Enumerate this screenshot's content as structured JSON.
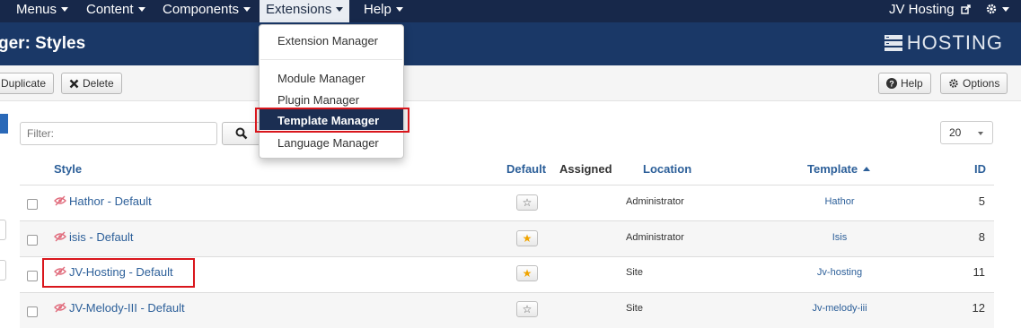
{
  "navbar": {
    "menus": [
      {
        "label": "Menus"
      },
      {
        "label": "Content"
      },
      {
        "label": "Components"
      },
      {
        "label": "Extensions"
      },
      {
        "label": "Help"
      }
    ],
    "site_link": "JV Hosting"
  },
  "header": {
    "title": "ger: Styles",
    "brand": "HOSTING"
  },
  "toolbar": {
    "duplicate": "Duplicate",
    "delete": "Delete",
    "help": "Help",
    "options": "Options"
  },
  "filter": {
    "placeholder": "Filter:"
  },
  "list_limit": "20",
  "extensions_menu": {
    "items": [
      "Extension Manager",
      "Module Manager",
      "Plugin Manager",
      "Template Manager",
      "Language Manager"
    ],
    "active": "Template Manager"
  },
  "table": {
    "headers": {
      "style": "Style",
      "default": "Default",
      "assigned": "Assigned",
      "location": "Location",
      "template": "Template",
      "id": "ID"
    },
    "rows": [
      {
        "style": "Hathor - Default",
        "default": false,
        "location": "Administrator",
        "template": "Hathor",
        "id": "5"
      },
      {
        "style": "isis - Default",
        "default": true,
        "location": "Administrator",
        "template": "Isis",
        "id": "8"
      },
      {
        "style": "JV-Hosting - Default",
        "default": true,
        "location": "Site",
        "template": "Jv-hosting",
        "id": "11"
      },
      {
        "style": "JV-Melody-III - Default",
        "default": false,
        "location": "Site",
        "template": "Jv-melody-iii",
        "id": "12"
      }
    ]
  },
  "colors": {
    "navbar": "#17284a",
    "header": "#1a3867",
    "link": "#2c5f99",
    "highlight": "#d9161c",
    "star": "#f0a400"
  }
}
